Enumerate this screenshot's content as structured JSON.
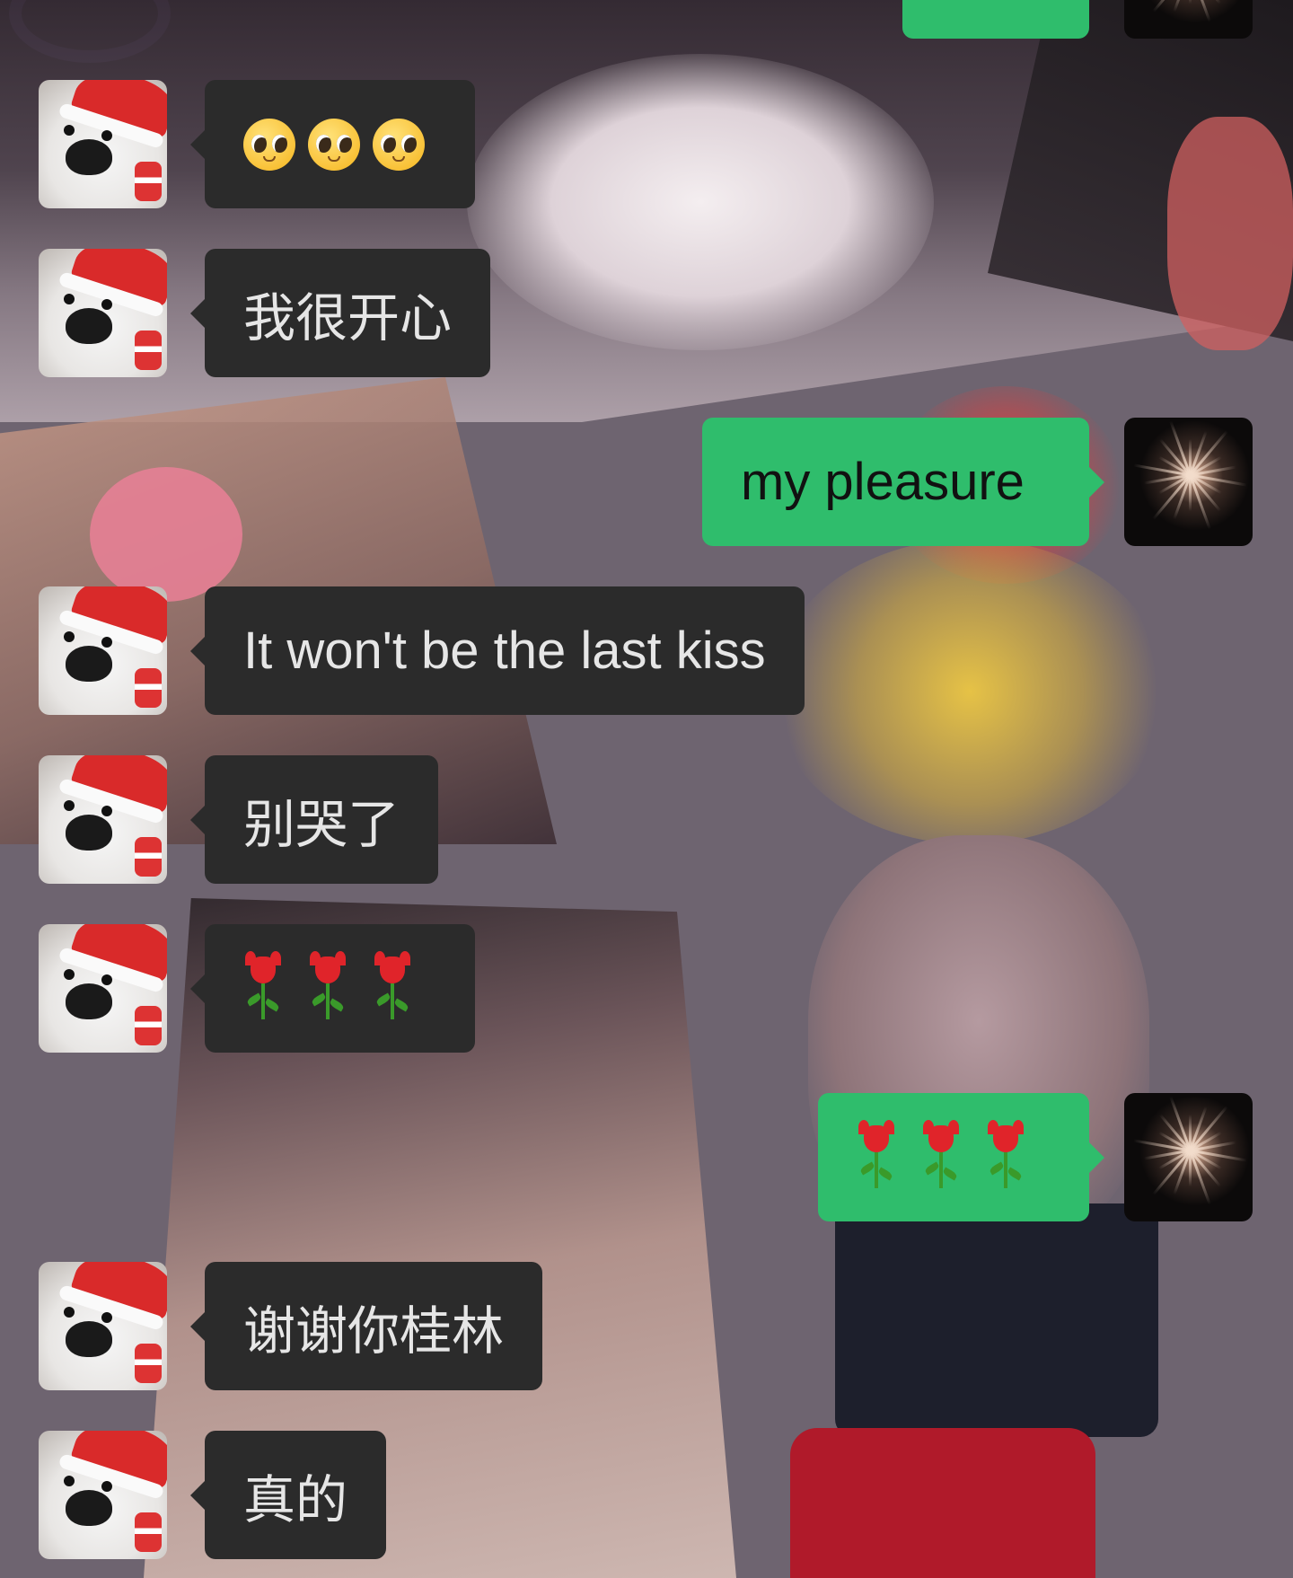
{
  "colors": {
    "incoming_bubble": "#2b2b2b",
    "outgoing_bubble": "#2fbd6c",
    "incoming_text": "#e6e6e6",
    "outgoing_text": "#111111"
  },
  "contact_avatar": "white-dog-santa-hat-avatar",
  "self_avatar": "fireworks-avatar",
  "messages": [
    {
      "id": "m1",
      "sender": "self",
      "text": "",
      "partially_visible": true
    },
    {
      "id": "m2",
      "sender": "contact",
      "emoji": [
        "pleading-face-icon",
        "pleading-face-icon",
        "pleading-face-icon"
      ]
    },
    {
      "id": "m3",
      "sender": "contact",
      "text": "我很开心"
    },
    {
      "id": "m4",
      "sender": "self",
      "text": "my pleasure"
    },
    {
      "id": "m5",
      "sender": "contact",
      "text": "It won't be the last kiss"
    },
    {
      "id": "m6",
      "sender": "contact",
      "text": "别哭了"
    },
    {
      "id": "m7",
      "sender": "contact",
      "emoji": [
        "tulip-icon",
        "tulip-icon",
        "tulip-icon"
      ]
    },
    {
      "id": "m8",
      "sender": "self",
      "emoji": [
        "tulip-icon",
        "tulip-icon",
        "tulip-icon"
      ]
    },
    {
      "id": "m9",
      "sender": "contact",
      "text": "谢谢你桂林"
    },
    {
      "id": "m10",
      "sender": "contact",
      "text": "真的"
    }
  ]
}
